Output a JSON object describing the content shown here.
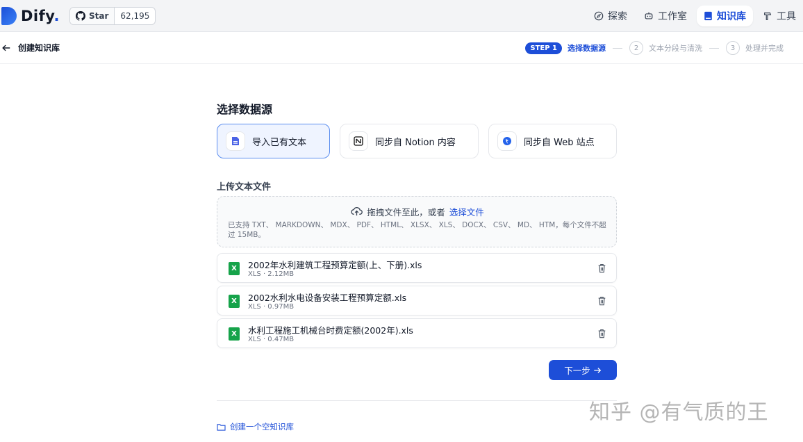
{
  "nav": {
    "logo": "Dify",
    "logo_dot": ".",
    "github_star": "Star",
    "github_count": "62,195",
    "links": [
      {
        "label": "探索",
        "icon": "compass-icon"
      },
      {
        "label": "工作室",
        "icon": "robot-icon"
      },
      {
        "label": "知识库",
        "icon": "book-icon",
        "active": true
      },
      {
        "label": "工具",
        "icon": "hammer-icon"
      }
    ]
  },
  "subheader": {
    "back_label": "创建知识库",
    "steps": [
      {
        "badge": "STEP 1",
        "label": "选择数据源"
      },
      {
        "num": "2",
        "label": "文本分段与清洗"
      },
      {
        "num": "3",
        "label": "处理并完成"
      }
    ]
  },
  "main": {
    "section_title": "选择数据源",
    "sources": [
      {
        "label": "导入已有文本",
        "icon": "file-text-icon"
      },
      {
        "label": "同步自 Notion 内容",
        "icon": "notion-icon"
      },
      {
        "label": "同步自 Web 站点",
        "icon": "web-icon"
      }
    ],
    "upload_title": "上传文本文件",
    "dropzone": {
      "text": "拖拽文件至此，或者",
      "link": "选择文件",
      "support": "已支持 TXT、 MARKDOWN、 MDX、 PDF、 HTML、 XLSX、 XLS、 DOCX、 CSV、 MD、 HTM，每个文件不超过 15MB。"
    },
    "files": [
      {
        "name": "2002年水利建筑工程预算定额(上、下册).xls",
        "meta": "XLS · 2.12MB",
        "icon": "X"
      },
      {
        "name": "2002水利水电设备安装工程预算定额.xls",
        "meta": "XLS · 0.97MB",
        "icon": "X"
      },
      {
        "name": "水利工程施工机械台时费定额(2002年).xls",
        "meta": "XLS · 0.47MB",
        "icon": "X"
      }
    ],
    "next_label": "下一步",
    "empty_kb_label": "创建一个空知识库"
  },
  "watermark": "知乎 @有气质的王",
  "colors": {
    "accent": "#1d4ed8",
    "xls": "#16a34a"
  }
}
